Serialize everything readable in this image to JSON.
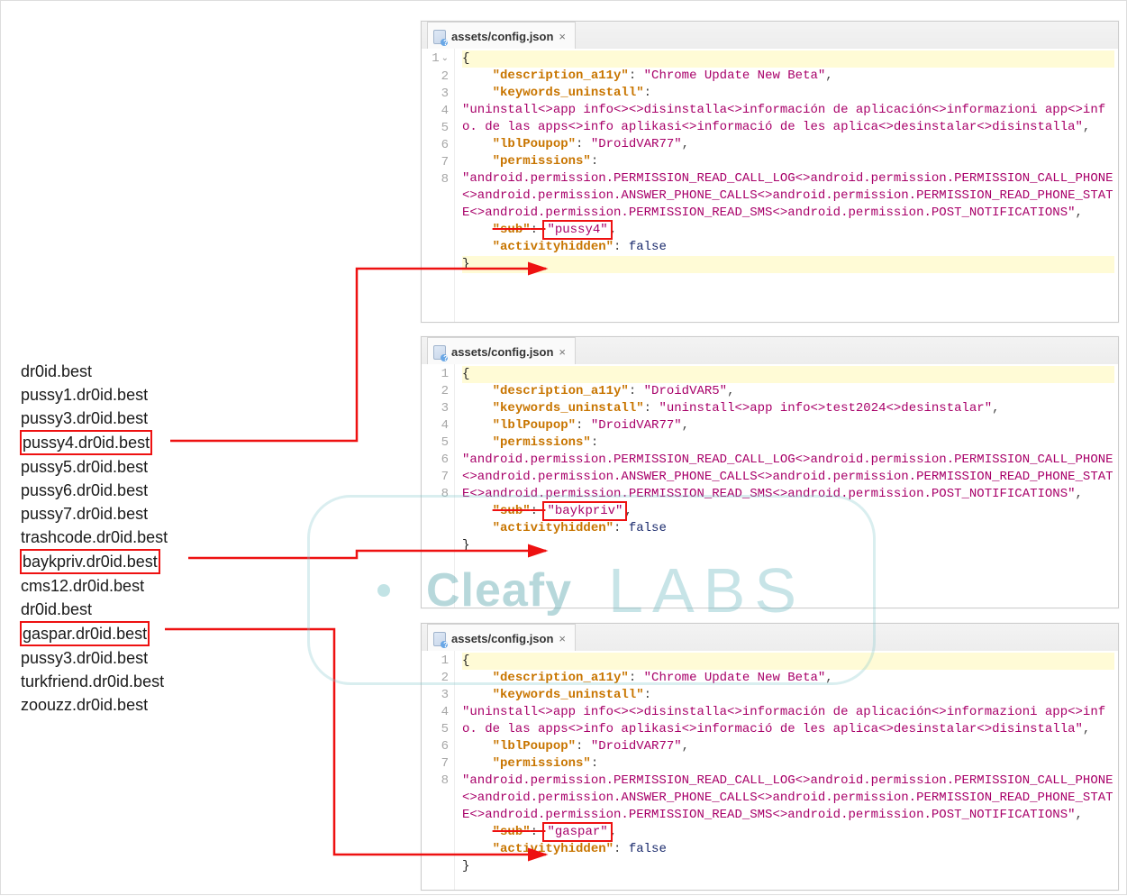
{
  "domains": [
    {
      "text": "dr0id.best",
      "boxed": false
    },
    {
      "text": "pussy1.dr0id.best",
      "boxed": false
    },
    {
      "text": "pussy3.dr0id.best",
      "boxed": false
    },
    {
      "text": "pussy4.dr0id.best",
      "boxed": true
    },
    {
      "text": "pussy5.dr0id.best",
      "boxed": false
    },
    {
      "text": "pussy6.dr0id.best",
      "boxed": false
    },
    {
      "text": "pussy7.dr0id.best",
      "boxed": false
    },
    {
      "text": "trashcode.dr0id.best",
      "boxed": false
    },
    {
      "text": "baykpriv.dr0id.best",
      "boxed": true
    },
    {
      "text": "cms12.dr0id.best",
      "boxed": false
    },
    {
      "text": "dr0id.best",
      "boxed": false
    },
    {
      "text": "gaspar.dr0id.best",
      "boxed": true
    },
    {
      "text": "pussy3.dr0id.best",
      "boxed": false
    },
    {
      "text": "turkfriend.dr0id.best",
      "boxed": false
    },
    {
      "text": "zoouzz.dr0id.best",
      "boxed": false
    }
  ],
  "editors": [
    {
      "id": "e1",
      "tab": "assets/config.json",
      "json": {
        "description_a11y": "Chrome Update New Beta",
        "keywords_uninstall": "uninstall<>app info<><>disinstalla<>información de aplicación<>informazioni app<>info. de las apps<>info aplikasi<>informació de les aplica<>desinstalar<>disinstalla",
        "lblPoupop": "DroidVAR77",
        "permissions": "android.permission.PERMISSION_READ_CALL_LOG<>android.permission.PERMISSION_CALL_PHONE<>android.permission.ANSWER_PHONE_CALLS<>android.permission.PERMISSION_READ_PHONE_STATE<>android.permission.PERMISSION_READ_SMS<>android.permission.POST_NOTIFICATIONS",
        "sub": "pussy4",
        "activityhidden": "false"
      },
      "lines": [
        "1",
        "2",
        "3",
        "4",
        "5",
        "6",
        "7",
        "8"
      ]
    },
    {
      "id": "e2",
      "tab": "assets/config.json",
      "json": {
        "description_a11y": "DroidVAR5",
        "keywords_uninstall": "uninstall<>app info<>test2024<>desinstalar",
        "lblPoupop": "DroidVAR77",
        "permissions": "android.permission.PERMISSION_READ_CALL_LOG<>android.permission.PERMISSION_CALL_PHONE<>android.permission.ANSWER_PHONE_CALLS<>android.permission.PERMISSION_READ_PHONE_STATE<>android.permission.PERMISSION_READ_SMS<>android.permission.POST_NOTIFICATIONS",
        "sub": "baykpriv",
        "activityhidden": "false"
      },
      "lines": [
        "1",
        "2",
        "3",
        "4",
        "5",
        "6",
        "7",
        "8"
      ]
    },
    {
      "id": "e3",
      "tab": "assets/config.json",
      "json": {
        "description_a11y": "Chrome Update New Beta",
        "keywords_uninstall": "uninstall<>app info<><>disinstalla<>información de aplicación<>informazioni app<>info. de las apps<>info aplikasi<>informació de les aplica<>desinstalar<>disinstalla",
        "lblPoupop": "DroidVAR77",
        "permissions": "android.permission.PERMISSION_READ_CALL_LOG<>android.permission.PERMISSION_CALL_PHONE<>android.permission.ANSWER_PHONE_CALLS<>android.permission.PERMISSION_READ_PHONE_STATE<>android.permission.PERMISSION_READ_SMS<>android.permission.POST_NOTIFICATIONS",
        "sub": "gaspar",
        "activityhidden": "false"
      },
      "lines": [
        "1",
        "2",
        "3",
        "4",
        "5",
        "6",
        "7",
        "8"
      ]
    }
  ],
  "watermark": {
    "left": "Cleafy",
    "right": "LABS"
  }
}
